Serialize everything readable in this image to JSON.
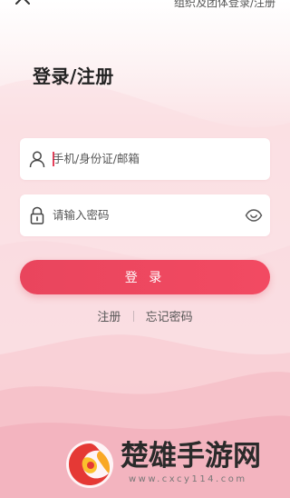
{
  "header": {
    "org_login_link": "组织及团体登录/注册"
  },
  "page_title": "登录/注册",
  "form": {
    "account_placeholder": "手机/身份证/邮箱",
    "password_placeholder": "请输入密码",
    "login_button": "登 录"
  },
  "links": {
    "register": "注册",
    "forgot_password": "忘记密码"
  },
  "watermark": {
    "site_name": "楚雄手游网",
    "url": "www.cxcy114.com"
  },
  "colors": {
    "accent": "#ee4760",
    "background_pink": "#fbe3e6"
  },
  "icons": {
    "close": "close-icon",
    "user": "user-icon",
    "lock": "lock-icon",
    "eye": "eye-icon"
  }
}
